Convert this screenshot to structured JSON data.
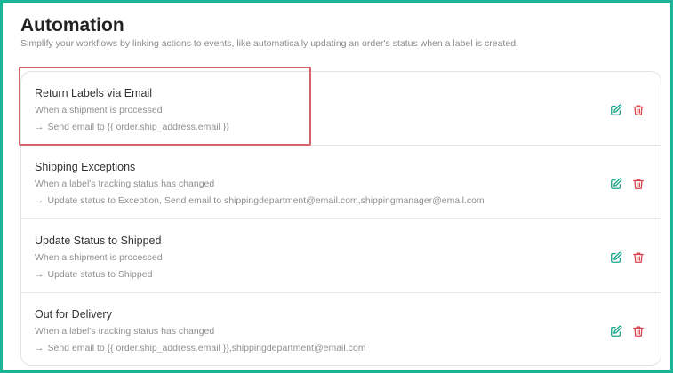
{
  "page": {
    "title": "Automation",
    "subtitle": "Simplify your workflows by linking actions to events, like automatically updating an order's status when a label is created."
  },
  "colors": {
    "frame_border": "#1db396",
    "edit_icon": "#1aa58a",
    "delete_icon": "#d9434f",
    "highlight": "#d4636e"
  },
  "icons": {
    "edit": "pencil-square-icon",
    "delete": "trash-icon",
    "arrow": "→"
  },
  "automations": [
    {
      "title": "Return Labels via Email",
      "trigger": "When a shipment is processed",
      "action": "Send email to {{ order.ship_address.email }}"
    },
    {
      "title": "Shipping Exceptions",
      "trigger": "When a label's tracking status has changed",
      "action": "Update status to Exception, Send email to shippingdepartment@email.com,shippingmanager@email.com"
    },
    {
      "title": "Update Status to Shipped",
      "trigger": "When a shipment is processed",
      "action": "Update status to Shipped"
    },
    {
      "title": "Out for Delivery",
      "trigger": "When a label's tracking status has changed",
      "action": "Send email to {{ order.ship_address.email }},shippingdepartment@email.com"
    }
  ]
}
